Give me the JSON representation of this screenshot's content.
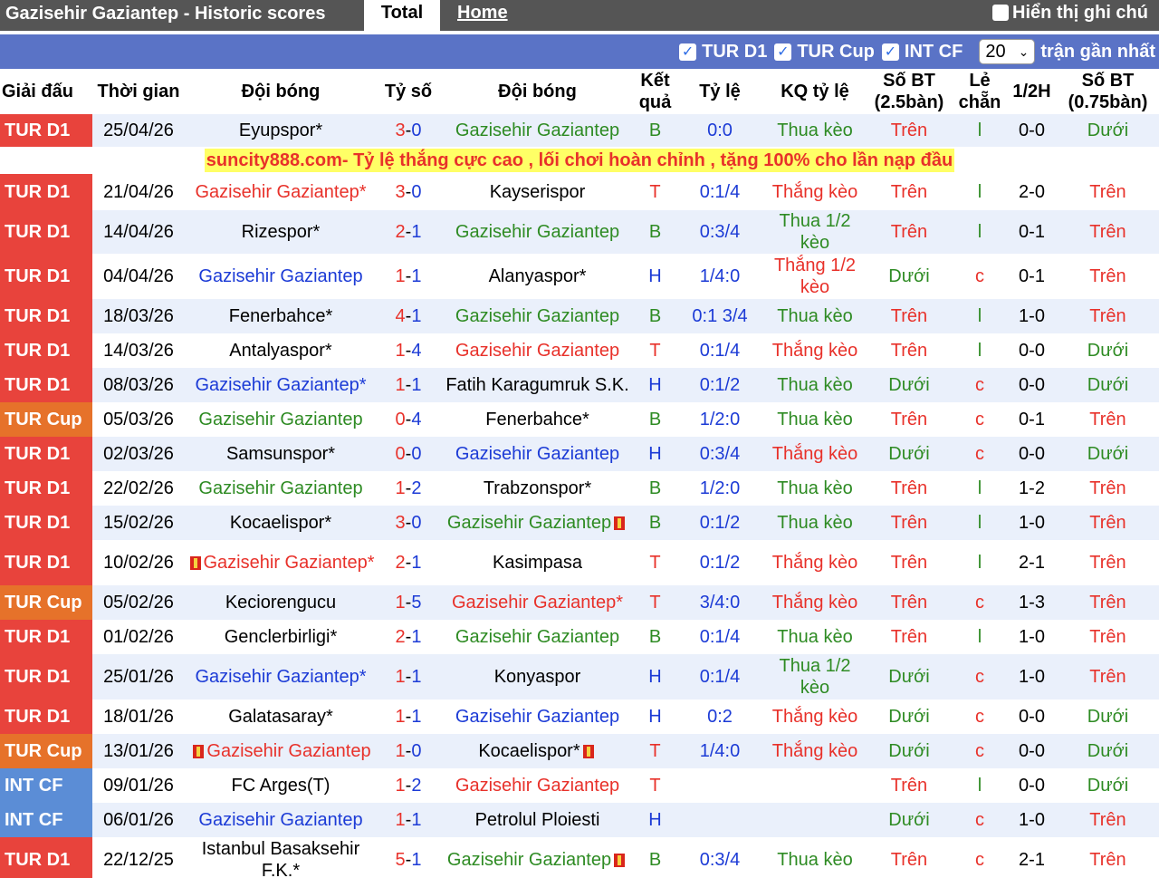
{
  "header": {
    "title": "Gazisehir Gaziantep - Historic scores",
    "tab_total": "Total",
    "tab_home": "Home",
    "show_notes": "Hiển thị ghi chú"
  },
  "filters": {
    "items": [
      {
        "label": "TUR D1",
        "checked": true
      },
      {
        "label": "TUR Cup",
        "checked": true
      },
      {
        "label": "INT CF",
        "checked": true
      }
    ],
    "count_value": "20",
    "recent_label": "trận gần nhất"
  },
  "columns": [
    "Giải đấu",
    "Thời gian",
    "Đội bóng",
    "Tỷ số",
    "Đội bóng",
    "Kết quả",
    "Tỷ lệ",
    "KQ tỷ lệ",
    "Số BT (2.5bàn)",
    "Lẻ chẵn",
    "1/2H",
    "Số BT (0.75bàn)"
  ],
  "ad_text": "suncity888.com- Tỷ lệ thắng cực cao , lối chơi hoàn chỉnh , tặng 100% cho lần nạp đầu",
  "colors": {
    "tur_d1": "#e8433c",
    "tur_cup": "#e6722a",
    "int_cf": "#5b8dd6",
    "win": "#e8312a",
    "draw": "#1c3bd6",
    "loss": "#2e8b23"
  },
  "rows": [
    {
      "league": "TUR D1",
      "date": "25/04/26",
      "home": "Eyupspor*",
      "home_color": "black",
      "score_h": "3",
      "score_a": "0",
      "away": "Gazisehir Gaziantep",
      "away_color": "green",
      "result": "B",
      "handicap": "0:0",
      "hcp_result": "Thua kèo",
      "ou": "Trên",
      "oe": "l",
      "ht": "0-0",
      "ou75": "Dưới"
    },
    {
      "league": "TUR D1",
      "date": "21/04/26",
      "home": "Gazisehir Gaziantep*",
      "home_color": "red",
      "score_h": "3",
      "score_a": "0",
      "away": "Kayserispor",
      "away_color": "black",
      "result": "T",
      "handicap": "0:1/4",
      "hcp_result": "Thắng kèo",
      "ou": "Trên",
      "oe": "l",
      "ht": "2-0",
      "ou75": "Trên"
    },
    {
      "league": "TUR D1",
      "date": "14/04/26",
      "home": "Rizespor*",
      "home_color": "black",
      "score_h": "2",
      "score_a": "1",
      "away": "Gazisehir Gaziantep",
      "away_color": "green",
      "result": "B",
      "handicap": "0:3/4",
      "hcp_result": "Thua 1/2 kèo",
      "ou": "Trên",
      "oe": "l",
      "ht": "0-1",
      "ou75": "Trên"
    },
    {
      "league": "TUR D1",
      "date": "04/04/26",
      "home": "Gazisehir Gaziantep",
      "home_color": "blue",
      "score_h": "1",
      "score_a": "1",
      "away": "Alanyaspor*",
      "away_color": "black",
      "result": "H",
      "handicap": "1/4:0",
      "hcp_result": "Thắng 1/2 kèo",
      "ou": "Dưới",
      "oe": "c",
      "ht": "0-1",
      "ou75": "Trên"
    },
    {
      "league": "TUR D1",
      "date": "18/03/26",
      "home": "Fenerbahce*",
      "home_color": "black",
      "score_h": "4",
      "score_a": "1",
      "away": "Gazisehir Gaziantep",
      "away_color": "green",
      "result": "B",
      "handicap": "0:1 3/4",
      "hcp_result": "Thua kèo",
      "ou": "Trên",
      "oe": "l",
      "ht": "1-0",
      "ou75": "Trên"
    },
    {
      "league": "TUR D1",
      "date": "14/03/26",
      "home": "Antalyaspor*",
      "home_color": "black",
      "score_h": "1",
      "score_a": "4",
      "away": "Gazisehir Gaziantep",
      "away_color": "red",
      "result": "T",
      "handicap": "0:1/4",
      "hcp_result": "Thắng kèo",
      "ou": "Trên",
      "oe": "l",
      "ht": "0-0",
      "ou75": "Dưới"
    },
    {
      "league": "TUR D1",
      "date": "08/03/26",
      "home": "Gazisehir Gaziantep*",
      "home_color": "blue",
      "score_h": "1",
      "score_a": "1",
      "away": "Fatih Karagumruk S.K.",
      "away_color": "black",
      "result": "H",
      "handicap": "0:1/2",
      "hcp_result": "Thua kèo",
      "ou": "Dưới",
      "oe": "c",
      "ht": "0-0",
      "ou75": "Dưới"
    },
    {
      "league": "TUR Cup",
      "date": "05/03/26",
      "home": "Gazisehir Gaziantep",
      "home_color": "green",
      "score_h": "0",
      "score_a": "4",
      "away": "Fenerbahce*",
      "away_color": "black",
      "result": "B",
      "handicap": "1/2:0",
      "hcp_result": "Thua kèo",
      "ou": "Trên",
      "oe": "c",
      "ht": "0-1",
      "ou75": "Trên"
    },
    {
      "league": "TUR D1",
      "date": "02/03/26",
      "home": "Samsunspor*",
      "home_color": "black",
      "score_h": "0",
      "score_a": "0",
      "away": "Gazisehir Gaziantep",
      "away_color": "blue",
      "result": "H",
      "handicap": "0:3/4",
      "hcp_result": "Thắng kèo",
      "ou": "Dưới",
      "oe": "c",
      "ht": "0-0",
      "ou75": "Dưới"
    },
    {
      "league": "TUR D1",
      "date": "22/02/26",
      "home": "Gazisehir Gaziantep",
      "home_color": "green",
      "score_h": "1",
      "score_a": "2",
      "away": "Trabzonspor*",
      "away_color": "black",
      "result": "B",
      "handicap": "1/2:0",
      "hcp_result": "Thua kèo",
      "ou": "Trên",
      "oe": "l",
      "ht": "1-2",
      "ou75": "Trên"
    },
    {
      "league": "TUR D1",
      "date": "15/02/26",
      "home": "Kocaelispor*",
      "home_color": "black",
      "score_h": "3",
      "score_a": "0",
      "away": "Gazisehir Gaziantep",
      "away_color": "green",
      "away_flag": true,
      "result": "B",
      "handicap": "0:1/2",
      "hcp_result": "Thua kèo",
      "ou": "Trên",
      "oe": "l",
      "ht": "1-0",
      "ou75": "Trên"
    },
    {
      "league": "TUR D1",
      "date": "10/02/26",
      "home": "Gazisehir Gaziantep*",
      "home_color": "red",
      "home_flag": true,
      "score_h": "2",
      "score_a": "1",
      "away": "Kasimpasa",
      "away_color": "black",
      "result": "T",
      "handicap": "0:1/2",
      "hcp_result": "Thắng kèo",
      "ou": "Trên",
      "oe": "l",
      "ht": "2-1",
      "ou75": "Trên"
    },
    {
      "league": "TUR Cup",
      "date": "05/02/26",
      "home": "Keciorengucu",
      "home_color": "black",
      "score_h": "1",
      "score_a": "5",
      "away": "Gazisehir Gaziantep*",
      "away_color": "red",
      "result": "T",
      "handicap": "3/4:0",
      "hcp_result": "Thắng kèo",
      "ou": "Trên",
      "oe": "c",
      "ht": "1-3",
      "ou75": "Trên"
    },
    {
      "league": "TUR D1",
      "date": "01/02/26",
      "home": "Genclerbirligi*",
      "home_color": "black",
      "score_h": "2",
      "score_a": "1",
      "away": "Gazisehir Gaziantep",
      "away_color": "green",
      "result": "B",
      "handicap": "0:1/4",
      "hcp_result": "Thua kèo",
      "ou": "Trên",
      "oe": "l",
      "ht": "1-0",
      "ou75": "Trên"
    },
    {
      "league": "TUR D1",
      "date": "25/01/26",
      "home": "Gazisehir Gaziantep*",
      "home_color": "blue",
      "score_h": "1",
      "score_a": "1",
      "away": "Konyaspor",
      "away_color": "black",
      "result": "H",
      "handicap": "0:1/4",
      "hcp_result": "Thua 1/2 kèo",
      "ou": "Dưới",
      "oe": "c",
      "ht": "1-0",
      "ou75": "Trên"
    },
    {
      "league": "TUR D1",
      "date": "18/01/26",
      "home": "Galatasaray*",
      "home_color": "black",
      "score_h": "1",
      "score_a": "1",
      "away": "Gazisehir Gaziantep",
      "away_color": "blue",
      "result": "H",
      "handicap": "0:2",
      "hcp_result": "Thắng kèo",
      "ou": "Dưới",
      "oe": "c",
      "ht": "0-0",
      "ou75": "Dưới"
    },
    {
      "league": "TUR Cup",
      "date": "13/01/26",
      "home": "Gazisehir Gaziantep",
      "home_color": "red",
      "home_flag": true,
      "score_h": "1",
      "score_a": "0",
      "away": "Kocaelispor*",
      "away_color": "black",
      "away_flag": true,
      "result": "T",
      "handicap": "1/4:0",
      "hcp_result": "Thắng kèo",
      "ou": "Dưới",
      "oe": "c",
      "ht": "0-0",
      "ou75": "Dưới"
    },
    {
      "league": "INT CF",
      "date": "09/01/26",
      "home": "FC Arges(T)",
      "home_color": "black",
      "score_h": "1",
      "score_a": "2",
      "away": "Gazisehir Gaziantep",
      "away_color": "red",
      "result": "T",
      "handicap": "",
      "hcp_result": "",
      "ou": "Trên",
      "oe": "l",
      "ht": "0-0",
      "ou75": "Dưới"
    },
    {
      "league": "INT CF",
      "date": "06/01/26",
      "home": "Gazisehir Gaziantep",
      "home_color": "blue",
      "score_h": "1",
      "score_a": "1",
      "away": "Petrolul Ploiesti",
      "away_color": "black",
      "result": "H",
      "handicap": "",
      "hcp_result": "",
      "ou": "Dưới",
      "oe": "c",
      "ht": "1-0",
      "ou75": "Trên"
    },
    {
      "league": "TUR D1",
      "date": "22/12/25",
      "home": "Istanbul Basaksehir F.K.*",
      "home_color": "black",
      "score_h": "5",
      "score_a": "1",
      "away": "Gazisehir Gaziantep",
      "away_color": "green",
      "away_flag": true,
      "result": "B",
      "handicap": "0:3/4",
      "hcp_result": "Thua kèo",
      "ou": "Trên",
      "oe": "c",
      "ht": "2-1",
      "ou75": "Trên"
    }
  ]
}
